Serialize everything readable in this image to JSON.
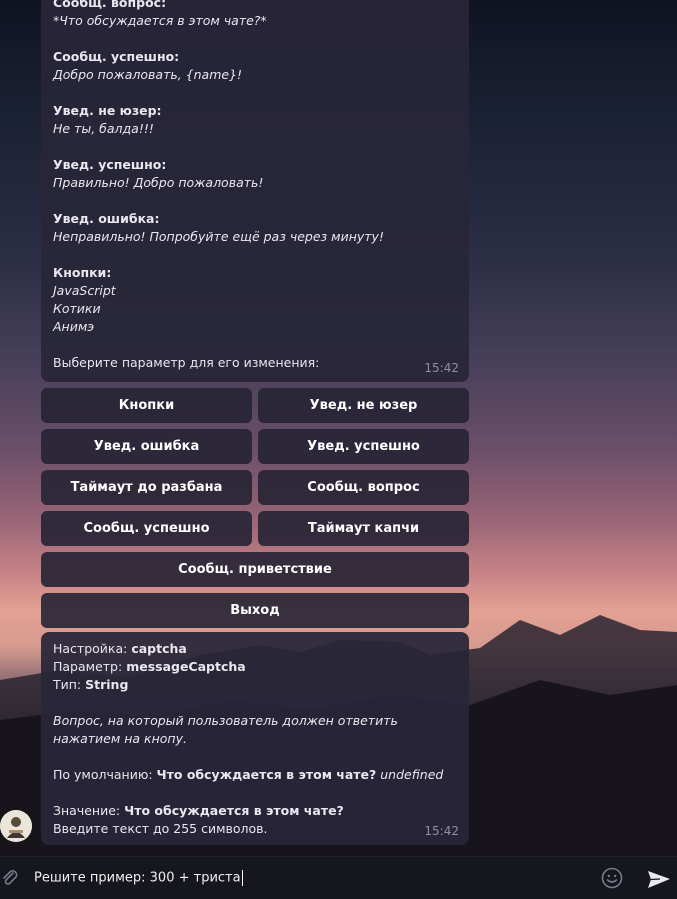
{
  "message_top": {
    "lines": [
      {
        "key": "Сообщ. вопрос:",
        "value": "*Что обсуждается в этом чате?*"
      },
      {
        "key": "Сообщ. успешно:",
        "value": "Добро пожаловать, {name}!"
      },
      {
        "key": "Увед. не юзер:",
        "value": "Не ты, балда!!!"
      },
      {
        "key": "Увед. успешно:",
        "value": "Правильно! Добро пожаловать!"
      },
      {
        "key": "Увед. ошибка:",
        "value": "Неправильно! Попробуйте ещё раз через минуту!"
      }
    ],
    "buttons_label": "Кнопки:",
    "buttons_values": [
      "JavaScript",
      "Котики",
      "Анимэ"
    ],
    "prompt": "Выберите параметр для его изменения:",
    "time": "15:42"
  },
  "keyboard": {
    "rows": [
      [
        "Кнопки",
        "Увед. не юзер"
      ],
      [
        "Увед. ошибка",
        "Увед. успешно"
      ],
      [
        "Таймаут до разбана",
        "Сообщ. вопрос"
      ],
      [
        "Сообщ. успешно",
        "Таймаут капчи"
      ]
    ],
    "greeting": "Сообщ. приветствие",
    "exit": "Выход"
  },
  "message_bottom": {
    "setting_label": "Настройка: ",
    "setting_value": "captcha",
    "param_label": "Параметр: ",
    "param_value": "messageCaptcha",
    "type_label": "Тип: ",
    "type_value": "String",
    "description": "Вопрос, на который пользователь должен ответить нажатием на кнопу.",
    "default_label": "По умолчанию: ",
    "default_value": "Что обсуждается в этом чате?",
    "default_extra": "undefined",
    "value_label": "Значение: ",
    "value_value": "Что обсуждается в этом чате?",
    "hint": "Введите текст до 255 символов.",
    "time": "15:42"
  },
  "input": {
    "value": "Решите пример: 300 + триста"
  },
  "icons": [
    "attach-icon",
    "emoji-icon",
    "send-icon"
  ]
}
